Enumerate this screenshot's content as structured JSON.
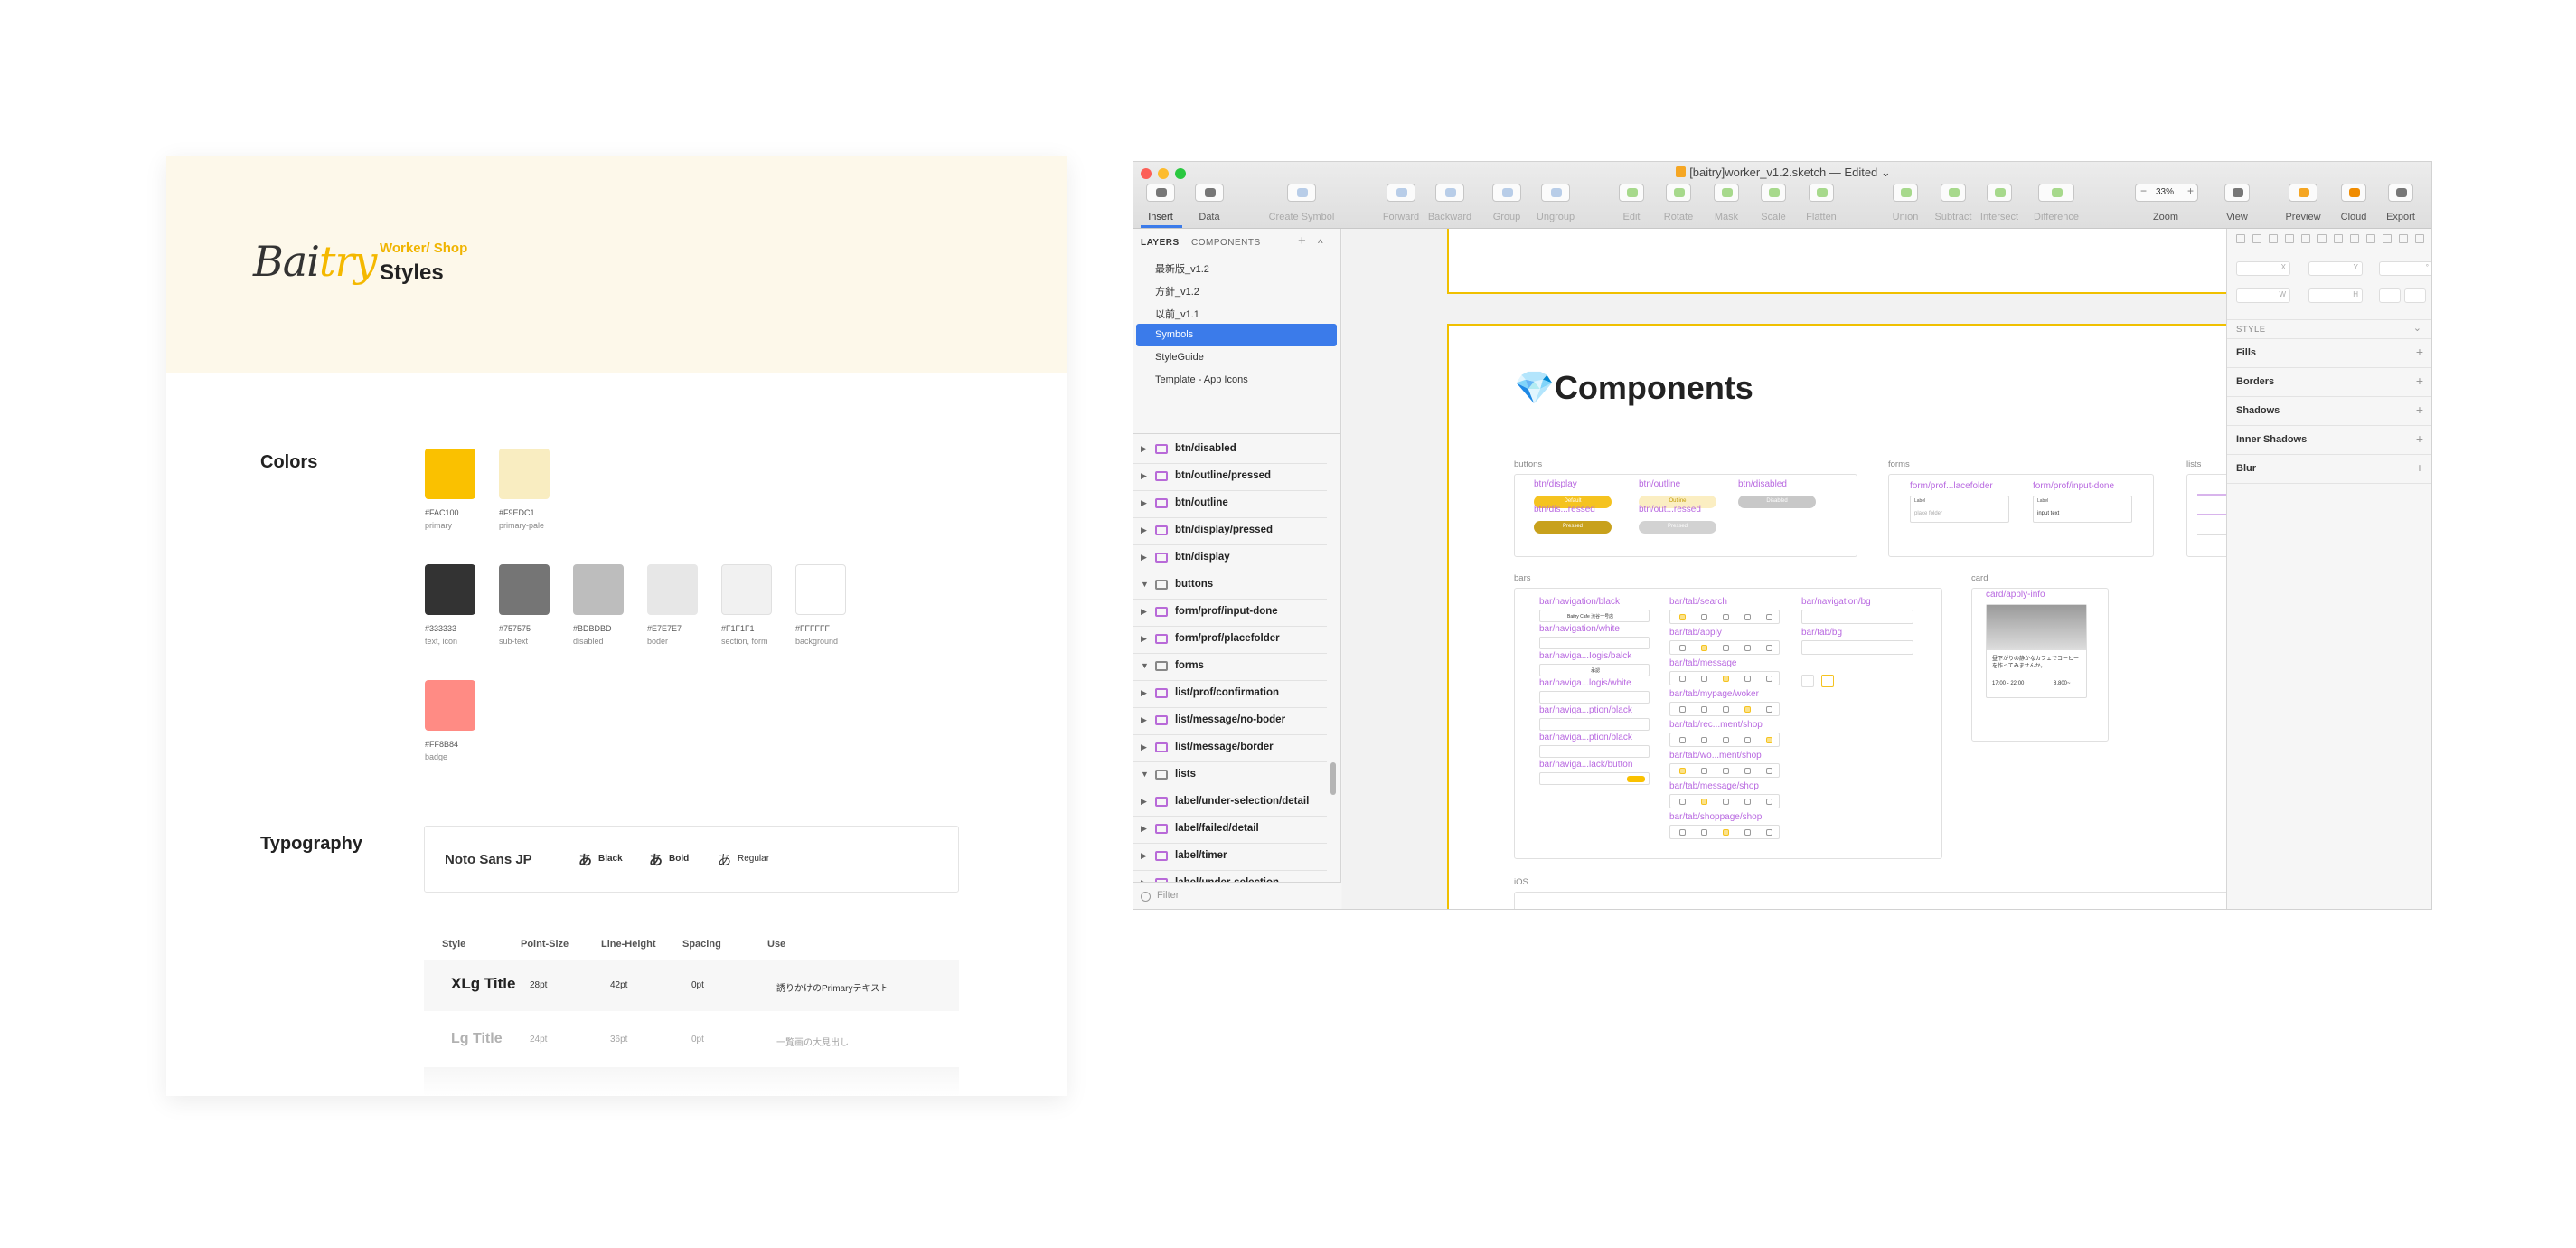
{
  "guide": {
    "brand": {
      "prefix": "Bai",
      "accent": "try"
    },
    "subtitle": "Worker/ Shop",
    "title": "Styles",
    "colors_heading": "Colors",
    "swatches": [
      {
        "hex": "#FAC100",
        "name": "primary",
        "color": "#FAC100"
      },
      {
        "hex": "#F9EDC1",
        "name": "primary-pale",
        "color": "#F9EDC1"
      },
      {
        "hex": "#333333",
        "name": "text, icon",
        "color": "#333333"
      },
      {
        "hex": "#757575",
        "name": "sub-text",
        "color": "#757575"
      },
      {
        "hex": "#BDBDBD",
        "name": "disabled",
        "color": "#BDBDBD"
      },
      {
        "hex": "#E7E7E7",
        "name": "boder",
        "color": "#E7E7E7"
      },
      {
        "hex": "#F1F1F1",
        "name": "section, form",
        "color": "#F1F1F1"
      },
      {
        "hex": "#FFFFFF",
        "name": "background",
        "color": "#FFFFFF"
      },
      {
        "hex": "#FF8B84",
        "name": "badge",
        "color": "#FF8B84"
      }
    ],
    "typography_heading": "Typography",
    "font_name": "Noto Sans JP",
    "font_glyph": "あ",
    "weights": [
      "Black",
      "Bold",
      "Regular"
    ],
    "table_headers": [
      "Style",
      "Point-Size",
      "Line-Height",
      "Spacing",
      "Use"
    ],
    "table_rows": [
      [
        "XLg Title",
        "28pt",
        "42pt",
        "0pt",
        "誘りかけのPrimaryテキスト"
      ],
      [
        "Lg Title",
        "24pt",
        "36pt",
        "0pt",
        "一覧画の大見出し"
      ]
    ]
  },
  "window": {
    "title": "[baitry]worker_v1.2.sketch — Edited",
    "title_chevron": "⌄",
    "toolbar": [
      {
        "label": "Insert",
        "enabled": true
      },
      {
        "label": "Data",
        "enabled": true
      },
      {
        "label": "Create Symbol",
        "enabled": false
      },
      {
        "label": "Forward",
        "enabled": false
      },
      {
        "label": "Backward",
        "enabled": false
      },
      {
        "label": "Group",
        "enabled": false
      },
      {
        "label": "Ungroup",
        "enabled": false
      },
      {
        "label": "Edit",
        "enabled": false
      },
      {
        "label": "Rotate",
        "enabled": false
      },
      {
        "label": "Mask",
        "enabled": false
      },
      {
        "label": "Scale",
        "enabled": false
      },
      {
        "label": "Flatten",
        "enabled": false
      },
      {
        "label": "Union",
        "enabled": false
      },
      {
        "label": "Subtract",
        "enabled": false
      },
      {
        "label": "Intersect",
        "enabled": false
      },
      {
        "label": "Difference",
        "enabled": false
      },
      {
        "label": "Zoom",
        "enabled": true
      },
      {
        "label": "View",
        "enabled": true
      },
      {
        "label": "Preview",
        "enabled": true
      },
      {
        "label": "Cloud",
        "enabled": true
      },
      {
        "label": "Export",
        "enabled": true
      }
    ],
    "zoom": "33%",
    "zoom_minus": "−",
    "zoom_plus": "+"
  },
  "layers_panel": {
    "tabs": [
      "LAYERS",
      "COMPONENTS"
    ],
    "add": "+",
    "collapse": "^",
    "pages": [
      "最新版_v1.2",
      "方針_v1.2",
      "以前_v1.1",
      "Symbols",
      "StyleGuide",
      "Template - App Icons"
    ],
    "selected_page": "Symbols",
    "layers": [
      {
        "name": "btn/disabled",
        "type": "symbol",
        "open": false
      },
      {
        "name": "btn/outline/pressed",
        "type": "symbol",
        "open": false
      },
      {
        "name": "btn/outline",
        "type": "symbol",
        "open": false
      },
      {
        "name": "btn/display/pressed",
        "type": "symbol",
        "open": false
      },
      {
        "name": "btn/display",
        "type": "symbol",
        "open": false
      },
      {
        "name": "buttons",
        "type": "group",
        "open": true
      },
      {
        "name": "form/prof/input-done",
        "type": "symbol",
        "open": false
      },
      {
        "name": "form/prof/placefolder",
        "type": "symbol",
        "open": false
      },
      {
        "name": "forms",
        "type": "group",
        "open": true
      },
      {
        "name": "list/prof/confirmation",
        "type": "symbol",
        "open": false
      },
      {
        "name": "list/message/no-boder",
        "type": "symbol",
        "open": false
      },
      {
        "name": "list/message/border",
        "type": "symbol",
        "open": false
      },
      {
        "name": "lists",
        "type": "group",
        "open": true
      },
      {
        "name": "label/under-selection/detail",
        "type": "symbol",
        "open": false
      },
      {
        "name": "label/failed/detail",
        "type": "symbol",
        "open": false
      },
      {
        "name": "label/timer",
        "type": "symbol",
        "open": false
      },
      {
        "name": "label/under-selection",
        "type": "symbol",
        "open": false
      }
    ],
    "filter_placeholder": "Filter"
  },
  "canvas": {
    "heading": "Components",
    "gem": "💎",
    "groups": {
      "buttons": "buttons",
      "forms": "forms",
      "lists": "lists",
      "bars": "bars",
      "card": "card",
      "ios": "iOS"
    },
    "button_symbols": [
      "btn/display",
      "btn/outline",
      "btn/disabled",
      "btn/dis...ressed",
      "btn/out...ressed"
    ],
    "button_texts": [
      "Default",
      "Outline",
      "Disabled",
      "Pressed",
      "Pressed"
    ],
    "form_symbols": [
      "form/prof...lacefolder",
      "form/prof/input-done"
    ],
    "form_labels": [
      "Label",
      "Label"
    ],
    "form_values": [
      "place folder",
      "input text"
    ],
    "bar_symbols_left": [
      "bar/navigation/black",
      "bar/navigation/white",
      "bar/naviga...Iogis/balck",
      "bar/naviga...logis/white",
      "bar/naviga...ption/black",
      "bar/naviga...ption/black",
      "bar/naviga...lack/button"
    ],
    "bar_symbols_mid": [
      "bar/tab/search",
      "bar/tab/apply",
      "bar/tab/message",
      "bar/tab/mypage/woker",
      "bar/tab/rec...ment/shop",
      "bar/tab/wo...ment/shop",
      "bar/tab/message/shop",
      "bar/tab/shoppage/shop"
    ],
    "bar_symbols_right": [
      "bar/navigation/bg",
      "bar/tab/bg"
    ],
    "nav_title": "Baitry Cafe 渋谷一号店",
    "nav_text": "承認",
    "card_symbol": "card/apply-info",
    "card_text": "昼下がりの静かなカフェでコーヒーを作ってみませんか。",
    "card_time": "17:00 - 22:00",
    "card_pay": "8,800~"
  },
  "inspector": {
    "style_heading": "STYLE",
    "sections": [
      "Fills",
      "Borders",
      "Shadows",
      "Inner Shadows",
      "Blur"
    ],
    "plus": "+",
    "fields": [
      "X",
      "Y",
      "°",
      "W",
      "H"
    ]
  },
  "colors": {
    "accent": "#FAC100",
    "selection": "#3B7BEA",
    "symbol": "#B868E0"
  }
}
